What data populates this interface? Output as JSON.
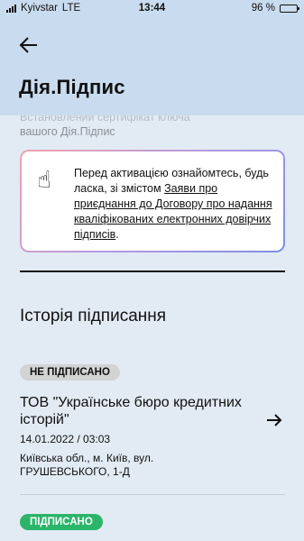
{
  "status_bar": {
    "carrier": "Kyivstar",
    "network": "LTE",
    "time": "13:44",
    "battery": "96 %",
    "battery_level": 0.96
  },
  "header": {
    "title": "Дія.Підпис",
    "back_icon": "arrow-left-icon"
  },
  "peek_text": {
    "line1": "Встановлений сертифікат ключа",
    "line2": "вашого Дія.Підпис"
  },
  "notice": {
    "icon": "pointing-hand-emoji",
    "text_before": "Перед активацією ознайомтесь, будь ласка, зі змістом ",
    "link_text": "Заяви про приєднання до Договору про надання кваліфікованих електронних довірчих підписів",
    "text_after": "."
  },
  "history": {
    "title": "Історія підписання",
    "items": [
      {
        "status": "НЕ ПІДПИСАНО",
        "organization": "ТОВ \"Українське бюро кредитних історій\"",
        "date": "14.01.2022 / 03:03",
        "address": "Київська обл., м. Київ, вул. ГРУШЕВСЬКОГО, 1-Д",
        "icon": "arrow-right-icon"
      },
      {
        "status": "ПІДПИСАНО"
      }
    ]
  },
  "colors": {
    "background": "#e2ebf4",
    "header": "#c9dbee",
    "signed_badge": "#2bb56a",
    "unsigned_badge": "#d3d3d3"
  }
}
